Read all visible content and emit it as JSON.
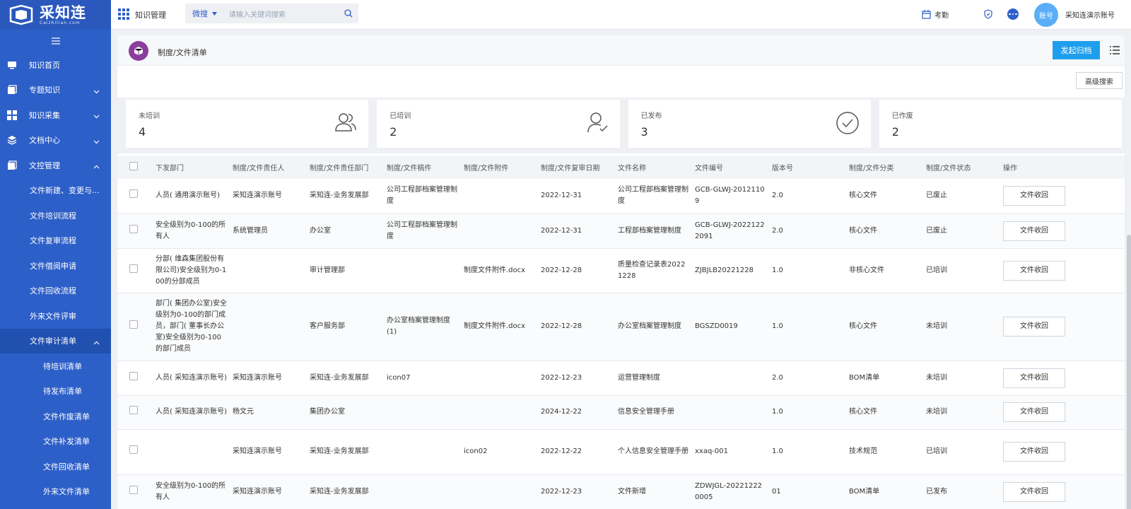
{
  "brand": {
    "name_cn": "采知连",
    "name_en": "Caizhilian.com"
  },
  "sidebar": {
    "items": [
      {
        "label": "知识首页",
        "icon": "monitor-icon",
        "level": 1,
        "chevron": ""
      },
      {
        "label": "专题知识",
        "icon": "stack-icon",
        "level": 1,
        "chevron": "down"
      },
      {
        "label": "知识采集",
        "icon": "grid-icon",
        "level": 1,
        "chevron": "down"
      },
      {
        "label": "文档中心",
        "icon": "layers-icon",
        "level": 1,
        "chevron": "down"
      },
      {
        "label": "文控管理",
        "icon": "stack-icon",
        "level": 1,
        "chevron": "up"
      },
      {
        "label": "文件新建、变更与...",
        "level": 2
      },
      {
        "label": "文件培训流程",
        "level": 2
      },
      {
        "label": "文件复审流程",
        "level": 2
      },
      {
        "label": "文件借阅申请",
        "level": 2
      },
      {
        "label": "文件回收流程",
        "level": 2
      },
      {
        "label": "外来文件评审",
        "level": 2
      },
      {
        "label": "文件审计清单",
        "level": 2,
        "chevron": "up",
        "active": true
      },
      {
        "label": "待培训清单",
        "level": 3
      },
      {
        "label": "待发布清单",
        "level": 3
      },
      {
        "label": "文件作废清单",
        "level": 3
      },
      {
        "label": "文件补发清单",
        "level": 3
      },
      {
        "label": "文件回收清单",
        "level": 3
      },
      {
        "label": "外来文件清单",
        "level": 3
      }
    ]
  },
  "topbar": {
    "module_title": "知识管理",
    "search_scope": "微搜",
    "search_placeholder": "请输入关键词搜索",
    "attendance": "考勤",
    "avatar": "账号",
    "username": "采知连演示账号"
  },
  "page": {
    "title": "制度/文件清单",
    "primary_button": "发起归档",
    "advanced_search": "高级搜索"
  },
  "stats": [
    {
      "label": "未培训",
      "value": "4",
      "icon": "users-icon"
    },
    {
      "label": "已培训",
      "value": "2",
      "icon": "user-check-icon"
    },
    {
      "label": "已发布",
      "value": "3",
      "icon": "check-circle-icon"
    },
    {
      "label": "已作废",
      "value": "2",
      "icon": ""
    }
  ],
  "table": {
    "headers": [
      "下发部门",
      "制度/文件责任人",
      "制度/文件责任部门",
      "制度/文件稿件",
      "制度/文件附件",
      "制度/文件复审日期",
      "文件名称",
      "文件编号",
      "版本号",
      "制度/文件分类",
      "制度/文件状态",
      "操作"
    ],
    "action_label": "文件收回",
    "rows": [
      [
        "人员( 通用演示账号)",
        "采知连演示账号",
        "采知连-业务发展部",
        "公司工程部档案管理制度",
        "",
        "2022-12-31",
        "公司工程部档案管理制度",
        "GCB-GLWJ-20121109",
        "2.0",
        "核心文件",
        "已废止"
      ],
      [
        "安全级别为0-100的所有人",
        "系统管理员",
        "办公室",
        "公司工程部档案管理制度",
        "",
        "2022-12-31",
        "工程部档案管理制度",
        "GCB-GLWJ-20221222091",
        "2.0",
        "核心文件",
        "已废止"
      ],
      [
        "分部( 维森集团股份有限公司)安全级别为0-100的分部成员",
        "",
        "审计管理部",
        "",
        "制度文件附件.docx",
        "2022-12-28",
        "质量检查记录表20221228",
        "ZJBJLB20221228",
        "1.0",
        "非核心文件",
        "已培训"
      ],
      [
        "部门( 集团办公室)安全级别为0-100的部门成员，部门( 董事长办公室)安全级别为0-100的部门成员",
        "",
        "客户服务部",
        "办公室档案管理制度(1)",
        "制度文件附件.docx",
        "2022-12-28",
        "办公室档案管理制度",
        "BGSZD0019",
        "1.0",
        "核心文件",
        "未培训"
      ],
      [
        "人员( 采知连演示账号)",
        "采知连演示账号",
        "采知连-业务发展部",
        "icon07",
        "",
        "2022-12-23",
        "运营管理制度",
        "",
        "2.0",
        "BOM清单",
        "未培训"
      ],
      [
        "人员( 采知连演示账号)",
        "杨文元",
        "集团办公室",
        "",
        "",
        "2024-12-22",
        "信息安全管理手册",
        "",
        "1.0",
        "核心文件",
        "未培训"
      ],
      [
        "",
        "采知连演示账号",
        "采知连-业务发展部",
        "",
        "icon02",
        "2022-12-22",
        "个人信息安全管理手册",
        "xxaq-001",
        "1.0",
        "技术规范",
        "已培训"
      ],
      [
        "安全级别为0-100的所有人",
        "采知连演示账号",
        "采知连-业务发展部",
        "",
        "",
        "2022-12-23",
        "文件新增",
        "ZDWJGL-202212220005",
        "01",
        "BOM清单",
        "已发布"
      ]
    ]
  },
  "colors": {
    "sidebar": "#2d5fc8",
    "primary_button": "#1e9fee",
    "page_icon": "#8a3d9c"
  }
}
